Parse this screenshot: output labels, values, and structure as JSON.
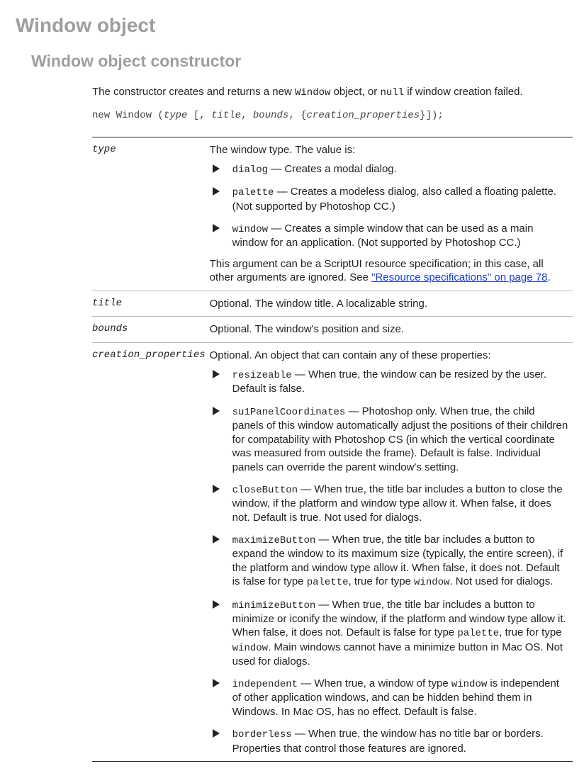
{
  "h1": "Window object",
  "h2": "Window object constructor",
  "intro": {
    "pre": "The constructor creates and returns a new ",
    "code1": "Window",
    "mid": " object, or ",
    "code2": "null",
    "post": " if window creation failed."
  },
  "syntax": {
    "p1": "new Window (",
    "em1": "type ",
    "p2": "[, ",
    "em2": "title",
    "p3": ", ",
    "em3": "bounds",
    "p4": ", {",
    "em4": "creation_properties",
    "p5": "}]);"
  },
  "rows": {
    "type": {
      "name": "type",
      "lead": "The window type. The value is:",
      "items": [
        {
          "code": "dialog",
          "text": " — Creates a modal dialog."
        },
        {
          "code": "palette",
          "text": " — Creates a modeless dialog, also called a floating palette. (Not supported by Photoshop CC.)"
        },
        {
          "code": "window",
          "text": " — Creates a simple window that can be used as a main window for an application. (Not supported by Photoshop CC.)"
        }
      ],
      "tail_pre": "This argument can be a ScriptUI resource specification; in this case, all other arguments are ignored. See ",
      "tail_link": "\"Resource specifications\" on page 78",
      "tail_post": "."
    },
    "title": {
      "name": "title",
      "desc": "Optional. The window title. A localizable string."
    },
    "bounds": {
      "name": "bounds",
      "desc": "Optional. The window's position and size."
    },
    "cp": {
      "name": "creation_properties",
      "lead": "Optional. An object that can contain any of these properties:",
      "items": {
        "resizeable": {
          "code": "resizeable",
          "text": " — When true, the window can be resized by the user. Default is false."
        },
        "su1": {
          "code": "su1PanelCoordinates",
          "text": " — Photoshop only. When true, the child panels of this window automatically adjust the positions of their children for compatability with Photoshop CS (in which the vertical coordinate was measured from outside the frame). Default is false. Individual panels can override the parent window's setting."
        },
        "closeButton": {
          "code": "closeButton",
          "text": " — When true, the title bar includes a button to close the window, if the platform and window type allow it. When false, it does not. Default is true. Not used for dialogs."
        },
        "maximize": {
          "code": "maximizeButton",
          "t1": " — When true, the title bar includes a button to expand the window to its maximum size (typically, the entire screen), if the platform and window type allow it. When false, it does not. Default is false for type ",
          "c1": "palette",
          "t2": ", true for type ",
          "c2": "window",
          "t3": ". Not used for dialogs."
        },
        "minimize": {
          "code": "minimizeButton",
          "t1": " — When true, the title bar includes a button to minimize or iconify the window, if the platform and window type allow it. When false, it does not. Default is false for type ",
          "c1": "palette",
          "t2": ", true for type ",
          "c2": "window",
          "t3": ". Main windows cannot have a minimize button in Mac OS. Not used for dialogs."
        },
        "independent": {
          "code": "independent",
          "t1": " — When true, a window of type ",
          "c1": "window",
          "t2": " is independent of other application windows, and can be hidden behind them in Windows. In Mac OS, has no effect. Default is false."
        },
        "borderless": {
          "code": "borderless",
          "text": " — When true, the window has no title bar or borders. Properties that control those features are ignored."
        }
      }
    }
  }
}
